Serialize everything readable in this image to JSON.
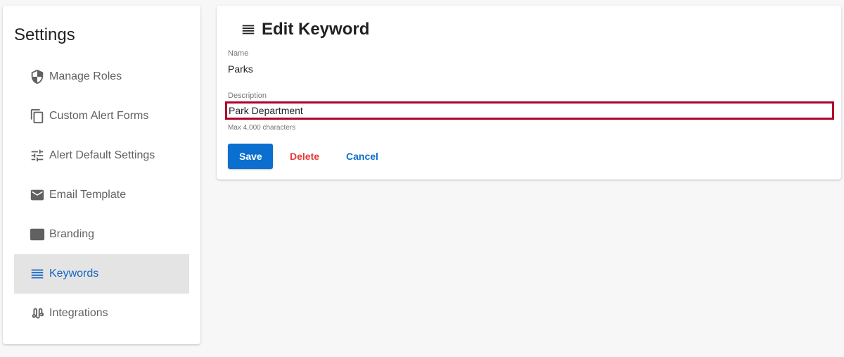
{
  "sidebar": {
    "title": "Settings",
    "items": [
      {
        "label": "Manage Roles",
        "icon": "shield-icon"
      },
      {
        "label": "Custom Alert Forms",
        "icon": "copy-icon"
      },
      {
        "label": "Alert Default Settings",
        "icon": "sliders-icon"
      },
      {
        "label": "Email Template",
        "icon": "mail-icon"
      },
      {
        "label": "Branding",
        "icon": "branding-icon"
      },
      {
        "label": "Keywords",
        "icon": "list-icon",
        "active": true
      },
      {
        "label": "Integrations",
        "icon": "integrations-icon"
      }
    ]
  },
  "editor": {
    "title": "Edit Keyword",
    "name_label": "Name",
    "name_value": "Parks",
    "description_label": "Description",
    "description_value": "Park Department",
    "helper_text": "Max 4,000 characters",
    "save_label": "Save",
    "delete_label": "Delete",
    "cancel_label": "Cancel"
  },
  "colors": {
    "accent": "#0a6fce",
    "active_nav": "#1565c0",
    "danger": "#e53935",
    "focus_outline": "#b0002a"
  }
}
